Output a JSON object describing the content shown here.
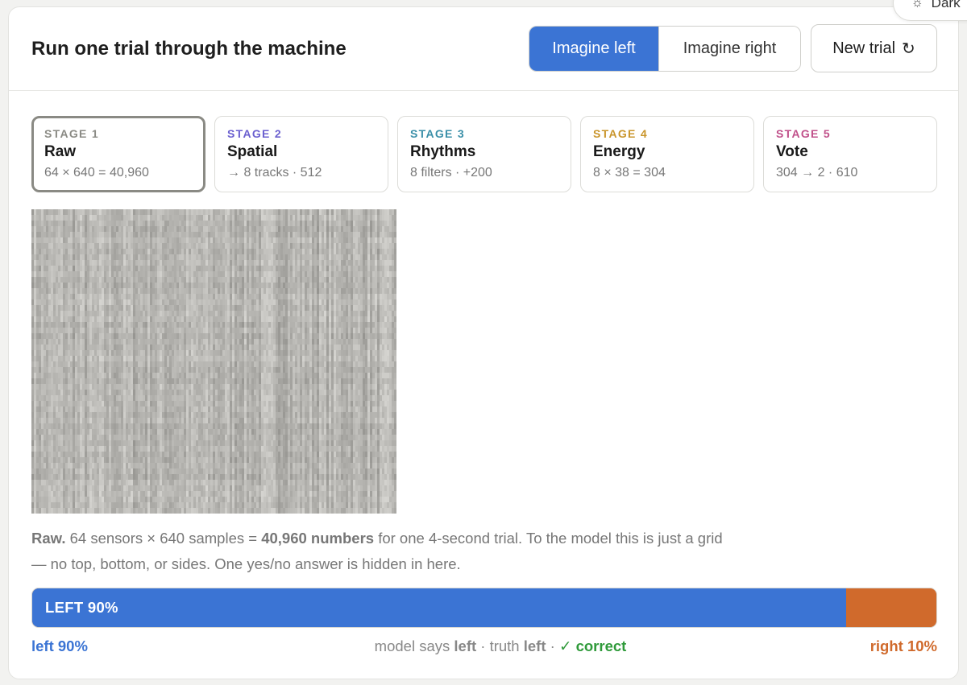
{
  "theme_toggle": {
    "icon": "sun-icon",
    "label": "Dark"
  },
  "header": {
    "title": "Run one trial through the machine",
    "imagine_left": "Imagine left",
    "imagine_right": "Imagine right",
    "new_trial": "New trial",
    "new_trial_icon": "↻"
  },
  "stages": [
    {
      "number": "STAGE 1",
      "name": "Raw",
      "desc": "64 × 640 = 40,960",
      "color": "#8a8a84",
      "active": true
    },
    {
      "number": "STAGE 2",
      "name": "Spatial",
      "desc": "→ 8 tracks · 512",
      "color": "#6a5fcf",
      "active": false
    },
    {
      "number": "STAGE 3",
      "name": "Rhythms",
      "desc": "8 filters · +200",
      "color": "#3a8fa8",
      "active": false
    },
    {
      "number": "STAGE 4",
      "name": "Energy",
      "desc": "8 × 38 = 304",
      "color": "#c9952b",
      "active": false
    },
    {
      "number": "STAGE 5",
      "name": "Vote",
      "desc": "304 → 2 · 610",
      "color": "#c0508a",
      "active": false
    }
  ],
  "caption": {
    "lead": "Raw.",
    "part1": " 64 sensors × 640 samples = ",
    "highlight": "40,960 numbers",
    "part2": " for one 4-second trial. To the model this is just a grid — no top, bottom, or sides. One yes/no answer is hidden in here."
  },
  "result": {
    "left_fraction": 0.9,
    "bar_label": "LEFT 90%",
    "left_label": "left 90%",
    "right_label": "right 10%",
    "says_prefix": "model says ",
    "says_value": "left",
    "truth_prefix": " · truth ",
    "truth_value": "left",
    "sep": " · ",
    "verdict": "✓ correct"
  },
  "colors": {
    "left": "#3b74d4",
    "right": "#d06a2c",
    "correct": "#2f9a3a"
  }
}
